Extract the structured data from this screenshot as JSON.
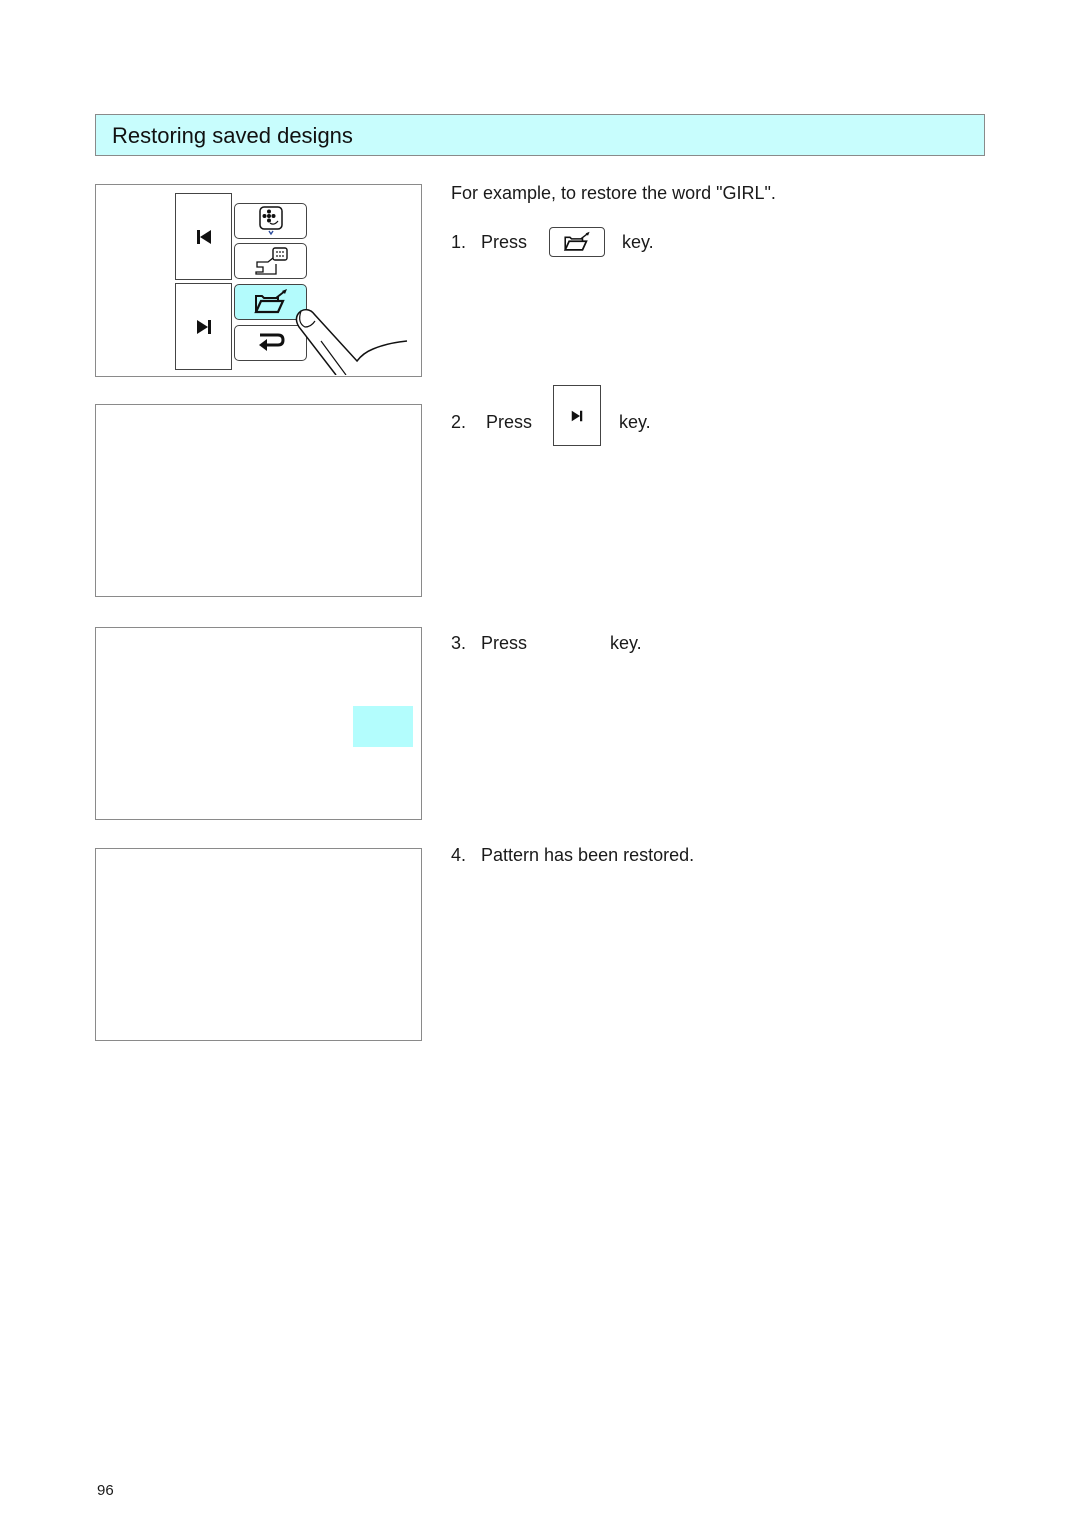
{
  "section": {
    "title": "Restoring saved designs",
    "accent_color": "#c8fdfd"
  },
  "intro": "For example, to restore the word \"GIRL\".",
  "steps": [
    {
      "number": "1.",
      "verb": "Press",
      "key_icon": "folder-open-icon",
      "suffix": "key."
    },
    {
      "number": "2.",
      "verb": "Press",
      "key_icon": "skip-forward-icon",
      "suffix": "key."
    },
    {
      "number": "3.",
      "verb": "Press",
      "key_icon": "",
      "suffix": "key."
    },
    {
      "number": "4.",
      "text": "Pattern has been restored."
    }
  ],
  "panels": [
    {
      "keys": {
        "nav": [
          "skip-back-icon",
          "skip-forward-icon"
        ],
        "functions": [
          "embroidery-flower-icon",
          "sewing-machine-icon",
          "folder-open-icon",
          "return-icon"
        ],
        "active_function": "folder-open-icon",
        "pointer": "finger-pointer-icon"
      }
    },
    {
      "content": ""
    },
    {
      "highlight_color": "#b3fdfd"
    },
    {
      "content": ""
    }
  ],
  "page_number": "96"
}
